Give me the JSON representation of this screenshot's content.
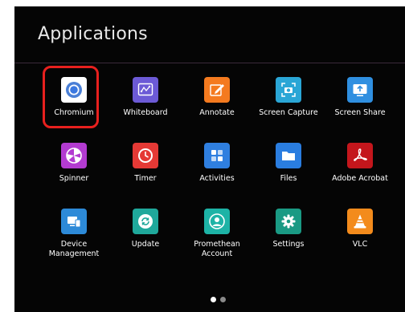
{
  "screen": {
    "title": "Applications",
    "accent_color": "#e8201e",
    "background_color": "#050505"
  },
  "apps": [
    {
      "label": "Chromium",
      "icon": "chromium-icon",
      "color": "#ffffff",
      "selected": true
    },
    {
      "label": "Whiteboard",
      "icon": "whiteboard-icon",
      "color": "#6c5ad6"
    },
    {
      "label": "Annotate",
      "icon": "annotate-icon",
      "color": "#f47a1f"
    },
    {
      "label": "Screen Capture",
      "icon": "screen-capture-icon",
      "color": "#2aa6d6"
    },
    {
      "label": "Screen Share",
      "icon": "screen-share-icon",
      "color": "#2f8fe0"
    },
    {
      "label": "Spinner",
      "icon": "spinner-icon",
      "color": "#b33bd1"
    },
    {
      "label": "Timer",
      "icon": "timer-icon",
      "color": "#e53935"
    },
    {
      "label": "Activities",
      "icon": "activities-icon",
      "color": "#2f7fe0"
    },
    {
      "label": "Files",
      "icon": "files-icon",
      "color": "#2a7de0"
    },
    {
      "label": "Adobe Acrobat",
      "icon": "adobe-acrobat-icon",
      "color": "#c4161c"
    },
    {
      "label": "Device Management",
      "icon": "device-management-icon",
      "color": "#2d8ad8"
    },
    {
      "label": "Update",
      "icon": "update-icon",
      "color": "#1fa89b"
    },
    {
      "label": "Promethean Account",
      "icon": "promethean-account-icon",
      "color": "#1db3a6"
    },
    {
      "label": "Settings",
      "icon": "settings-icon",
      "color": "#1a9a84"
    },
    {
      "label": "VLC",
      "icon": "vlc-icon",
      "color": "#f38b1c"
    }
  ],
  "pagination": {
    "pages": 2,
    "current": 1
  }
}
